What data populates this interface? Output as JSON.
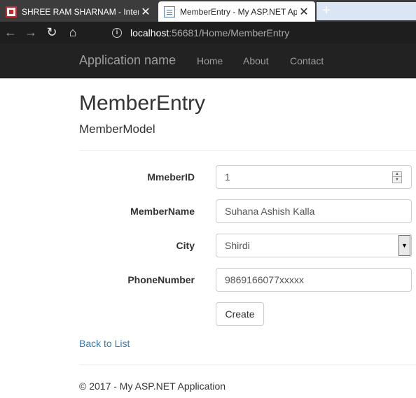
{
  "browser": {
    "tabs": [
      {
        "title": "SHREE RAM SHARNAM - Intern",
        "active": false
      },
      {
        "title": "MemberEntry - My ASP.NET Ap",
        "active": true
      }
    ],
    "new_tab_symbol": "+",
    "close_symbol": "✕",
    "url_host": "localhost",
    "url_rest": ":56681/Home/MemberEntry"
  },
  "navbar": {
    "brand": "Application name",
    "links": [
      "Home",
      "About",
      "Contact"
    ]
  },
  "page": {
    "title": "MemberEntry",
    "subtitle": "MemberModel"
  },
  "form": {
    "member_id": {
      "label": "MmeberID",
      "value": "1"
    },
    "member_name": {
      "label": "MemberName",
      "value": "Suhana Ashish Kalla"
    },
    "city": {
      "label": "City",
      "value": "Shirdi"
    },
    "phone": {
      "label": "PhoneNumber",
      "value": "9869166077xxxxx"
    },
    "submit_label": "Create"
  },
  "links": {
    "back": "Back to List"
  },
  "footer": {
    "text": "© 2017 - My ASP.NET Application"
  },
  "colors": {
    "navbar_bg": "#222222",
    "link": "#337ab7"
  },
  "icons": {
    "back": "arrow-left-icon",
    "forward": "arrow-right-icon",
    "reload": "reload-icon",
    "home": "home-icon",
    "info": "info-icon"
  }
}
